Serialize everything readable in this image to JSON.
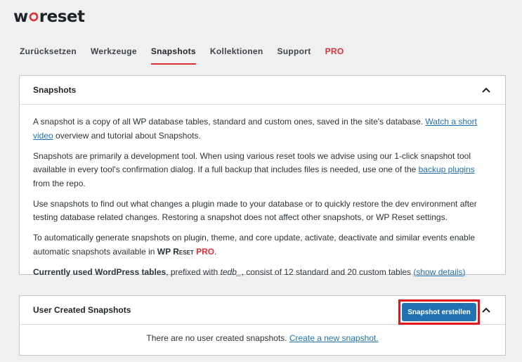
{
  "logo": {
    "pre": "w",
    "post": "reset"
  },
  "nav": {
    "tabs": [
      {
        "label": "Zurücksetzen"
      },
      {
        "label": "Werkzeuge"
      },
      {
        "label": "Snapshots"
      },
      {
        "label": "Kollektionen"
      },
      {
        "label": "Support"
      },
      {
        "label": "PRO"
      }
    ],
    "active": "Snapshots"
  },
  "snapshots_card": {
    "title": "Snapshots",
    "p1_text": "A snapshot is a copy of all WP database tables, standard and custom ones, saved in the site's database. ",
    "p1_link": "Watch a short video",
    "p1_after": " overview and tutorial about Snapshots.",
    "p2_text": "Snapshots are primarily a development tool. When using various reset tools we advise using our 1-click snapshot tool available in every tool's confirmation dialog. If a full backup that includes files is needed, use one of the ",
    "p2_link": "backup plugins",
    "p2_after": " from the repo.",
    "p3": "Use snapshots to find out what changes a plugin made to your database or to quickly restore the dev environment after testing database related changes. Restoring a snapshot does not affect other snapshots, or WP Reset settings.",
    "p4_text": "To automatically generate snapshots on plugin, theme, and core update, activate, deactivate and similar events enable automatic snapshots available in ",
    "p4_brand": "WP Reset",
    "p4_pro": "PRO",
    "p4_after": ".",
    "p5_bold": "Currently used WordPress tables",
    "p5_text1": ", prefixed with ",
    "p5_prefix": "tedb_",
    "p5_text2": ", consist of 12 standard and 20 custom tables ",
    "p5_link": "(show details)"
  },
  "user_card": {
    "title": "User Created Snapshots",
    "button_label": "Snapshot erstellen",
    "empty_text": "There are no user created snapshots. ",
    "empty_link": "Create a new snapshot."
  },
  "colors": {
    "accent": "#dd3036",
    "primary": "#2271b1",
    "highlight_border": "#e2141e"
  },
  "icons": {
    "logo_ring": "refresh-ring-icon",
    "collapse": "chevron-up-icon"
  }
}
